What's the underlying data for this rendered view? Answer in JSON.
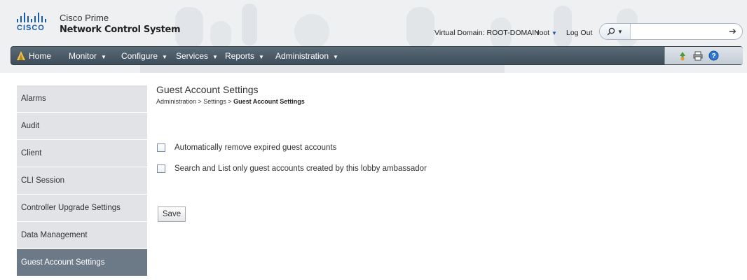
{
  "header": {
    "logo_text": "CISCO",
    "product_line1": "Cisco Prime",
    "product_line2": "Network Control System",
    "virtual_domain": "Virtual Domain: ROOT-DOMAIN",
    "user": "root",
    "logout": "Log Out",
    "search_placeholder": ""
  },
  "nav": {
    "items": [
      {
        "label": "Home"
      },
      {
        "label": "Monitor"
      },
      {
        "label": "Configure"
      },
      {
        "label": "Services"
      },
      {
        "label": "Reports"
      },
      {
        "label": "Administration"
      }
    ]
  },
  "sidebar": {
    "items": [
      {
        "label": "Alarms"
      },
      {
        "label": "Audit"
      },
      {
        "label": "Client"
      },
      {
        "label": "CLI Session"
      },
      {
        "label": "Controller Upgrade Settings"
      },
      {
        "label": "Data Management"
      },
      {
        "label": "Guest Account Settings",
        "active": true
      }
    ]
  },
  "main": {
    "title": "Guest Account Settings",
    "breadcrumb": {
      "part1": "Administration",
      "sep": " > ",
      "part2": "Settings",
      "current": "Guest Account Settings"
    },
    "options": [
      {
        "label": "Automatically remove expired guest accounts",
        "checked": false
      },
      {
        "label": "Search and List only guest accounts created by this lobby ambassador",
        "checked": false
      }
    ],
    "save_label": "Save"
  },
  "colors": {
    "nav_bar": "#4a5a66",
    "sidebar_bg": "#e1e3e6",
    "sidebar_active": "#6c7a88",
    "brand_blue": "#1a5aa6"
  },
  "icons": [
    "cisco-logo",
    "home-icon",
    "search-icon",
    "arrow-right-icon",
    "recycle-icon",
    "print-icon",
    "help-icon"
  ]
}
